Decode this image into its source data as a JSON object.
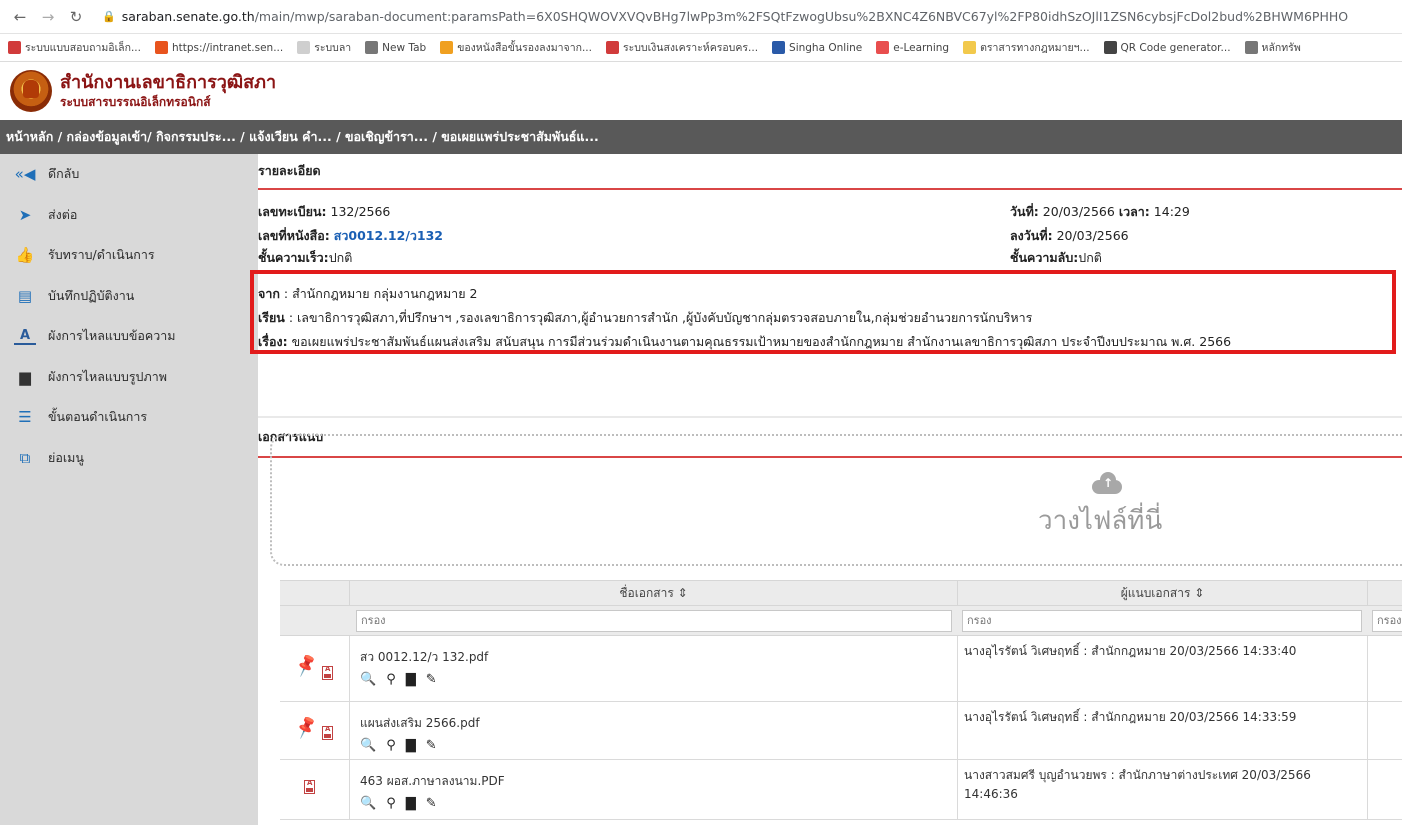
{
  "browser": {
    "url_host": "saraban.senate.go.th",
    "url_path": "/main/mwp/saraban-document:paramsPath=6X0SHQWOVXVQvBHg7lwPp3m%2FSQtFzwogUbsu%2BXNC4Z6NBVC67yl%2FP80idhSzOJlI1ZSN6cybsjFcDol2bud%2BHWM6PHHO",
    "bookmarks": [
      {
        "label": "ระบบแบบสอบถามอิเล็ก...",
        "color": "#d13b3b"
      },
      {
        "label": "https://intranet.sen...",
        "color": "#e8541e"
      },
      {
        "label": "ระบบลา",
        "color": "#cfcfcf"
      },
      {
        "label": "New Tab",
        "color": "#777777"
      },
      {
        "label": "ของหนังสือขั้นรองลงมาจาก...",
        "color": "#f0a020"
      },
      {
        "label": "ระบบเงินสงเคราะห์ครอบคร...",
        "color": "#d13b3b"
      },
      {
        "label": "Singha Online",
        "color": "#2a5aa8"
      },
      {
        "label": "e-Learning",
        "color": "#e84e4e"
      },
      {
        "label": "ตราสารทางกฎหมายฯ...",
        "color": "#f2c94c"
      },
      {
        "label": "QR Code generator...",
        "color": "#444444"
      },
      {
        "label": "หลักทรัพ",
        "color": "#777777"
      }
    ]
  },
  "app": {
    "title": "สำนักงานเลขาธิการวุฒิสภา",
    "subtitle": "ระบบสารบรรณอิเล็กทรอนิกส์",
    "breadcrumb": "หน้าหลัก / กล่องข้อมูลเข้า/ กิจกรรมประ... / แจ้งเวียน คำ... / ขอเชิญข้ารา... / ขอเผยแพร่ประชาสัมพันธ์แ..."
  },
  "sidebar": {
    "items": [
      {
        "label": "ดึกลับ",
        "icon": "back-arrow-icon",
        "glyph": "«◀"
      },
      {
        "label": "ส่งต่อ",
        "icon": "send-icon",
        "glyph": "➤"
      },
      {
        "label": "รับทราบ/ดำเนินการ",
        "icon": "thumbs-up-icon",
        "glyph": "👍"
      },
      {
        "label": "บันทึกปฏิบัติงาน",
        "icon": "notebook-icon",
        "glyph": "▤"
      },
      {
        "label": "ผังการไหลแบบข้อความ",
        "icon": "text-flow-icon",
        "glyph": "A"
      },
      {
        "label": "ผังการไหลแบบรูปภาพ",
        "icon": "image-flow-icon",
        "glyph": "▆"
      },
      {
        "label": "ขั้นตอนดำเนินการ",
        "icon": "list-steps-icon",
        "glyph": "☰"
      },
      {
        "label": "ย่อเมนู",
        "icon": "collapse-menu-icon",
        "glyph": "⧉"
      }
    ]
  },
  "details": {
    "section_title": "รายละเอียด",
    "reg_label": "เลขทะเบียน:",
    "reg_value": "132/2566",
    "doc_no_label": "เลขที่หนังสือ:",
    "doc_no_value": "สว0012.12/ว132",
    "speed_label": "ชั้นความเร็ว:",
    "speed_value": "ปกติ",
    "date_label": "วันที่:",
    "date_value": "20/03/2566",
    "time_label": "เวลา:",
    "time_value": "14:29",
    "sign_date_label": "ลงวันที่:",
    "sign_date_value": "20/03/2566",
    "secret_label": "ชั้นความลับ:",
    "secret_value": "ปกติ",
    "from_label": "จาก",
    "from_value": ": สำนักกฎหมาย กลุ่มงานกฎหมาย 2",
    "to_label": "เรียน",
    "to_value": ": เลขาธิการวุฒิสภา,ที่ปรึกษาฯ ,รองเลขาธิการวุฒิสภา,ผู้อำนวยการสำนัก ,ผู้บังคับบัญชากลุ่มตรวจสอบภายใน,กลุ่มช่วยอำนวยการนักบริหาร",
    "subject_label": "เรื่อง:",
    "subject_value": "ขอเผยแพร่ประชาสัมพันธ์แผนส่งเสริม สนับสนุน การมีส่วนร่วมดำเนินงานตามคุณธรรมเป้าหมายของสำนักกฎหมาย สำนักงานเลขาธิการวุฒิสภา ประจำปีงบประมาณ พ.ศ. 2566"
  },
  "attachments": {
    "section_title": "เอกสารแนบ",
    "dropzone_text": "วางไฟล์ที่นี่",
    "col_name": "ชื่อเอกสาร ⇕",
    "col_attacher": "ผู้แนบเอกสาร ⇕",
    "filter_placeholder": "กรอง",
    "filter_placeholder_short": "กรอง",
    "rows": [
      {
        "file": "สว 0012.12/ว 132.pdf",
        "attacher": "นางอุไรรัตน์ วิเศษฤทธิ์ : สำนักกฎหมาย 20/03/2566 14:33:40"
      },
      {
        "file": "แผนส่งเสริม 2566.pdf",
        "attacher": "นางอุไรรัตน์ วิเศษฤทธิ์ : สำนักกฎหมาย 20/03/2566 14:33:59"
      },
      {
        "file": "463 ผอส.ภาษาลงนาม.PDF",
        "attacher": "นางสาวสมศรี บุญอำนวยพร : สำนักภาษาต่างประเทศ 20/03/2566 14:46:36"
      }
    ]
  },
  "colors": {
    "brand_red": "#8b1414",
    "highlight": "#e21b1b",
    "breadcrumb_bg": "#595959",
    "sidebar_bg": "#d9d9d9",
    "link_blue": "#1a5fb4"
  }
}
